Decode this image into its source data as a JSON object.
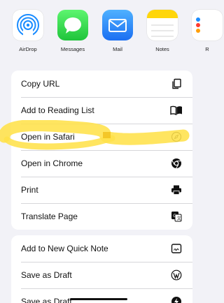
{
  "apps": [
    {
      "label": "AirDrop",
      "icon": "airdrop-icon"
    },
    {
      "label": "Messages",
      "icon": "messages-icon"
    },
    {
      "label": "Mail",
      "icon": "mail-icon"
    },
    {
      "label": "Notes",
      "icon": "notes-icon"
    },
    {
      "label": "R",
      "icon": "reminders-icon"
    }
  ],
  "group1": [
    {
      "label": "Copy URL",
      "icon": "copy-icon"
    },
    {
      "label": "Add to Reading List",
      "icon": "reading-list-icon"
    },
    {
      "label": "Open in Safari",
      "icon": "compass-icon"
    },
    {
      "label": "Open in Chrome",
      "icon": "chrome-icon"
    },
    {
      "label": "Print",
      "icon": "printer-icon"
    },
    {
      "label": "Translate Page",
      "icon": "translate-icon"
    }
  ],
  "group2": [
    {
      "label": "Add to New Quick Note",
      "icon": "quick-note-icon"
    },
    {
      "label": "Save as Draft",
      "icon": "wordpress-icon"
    },
    {
      "label": "Save as Draft",
      "icon": "draft-app-icon"
    }
  ],
  "colors": {
    "highlight": "#ffe14a",
    "background": "#f2f2f7"
  }
}
